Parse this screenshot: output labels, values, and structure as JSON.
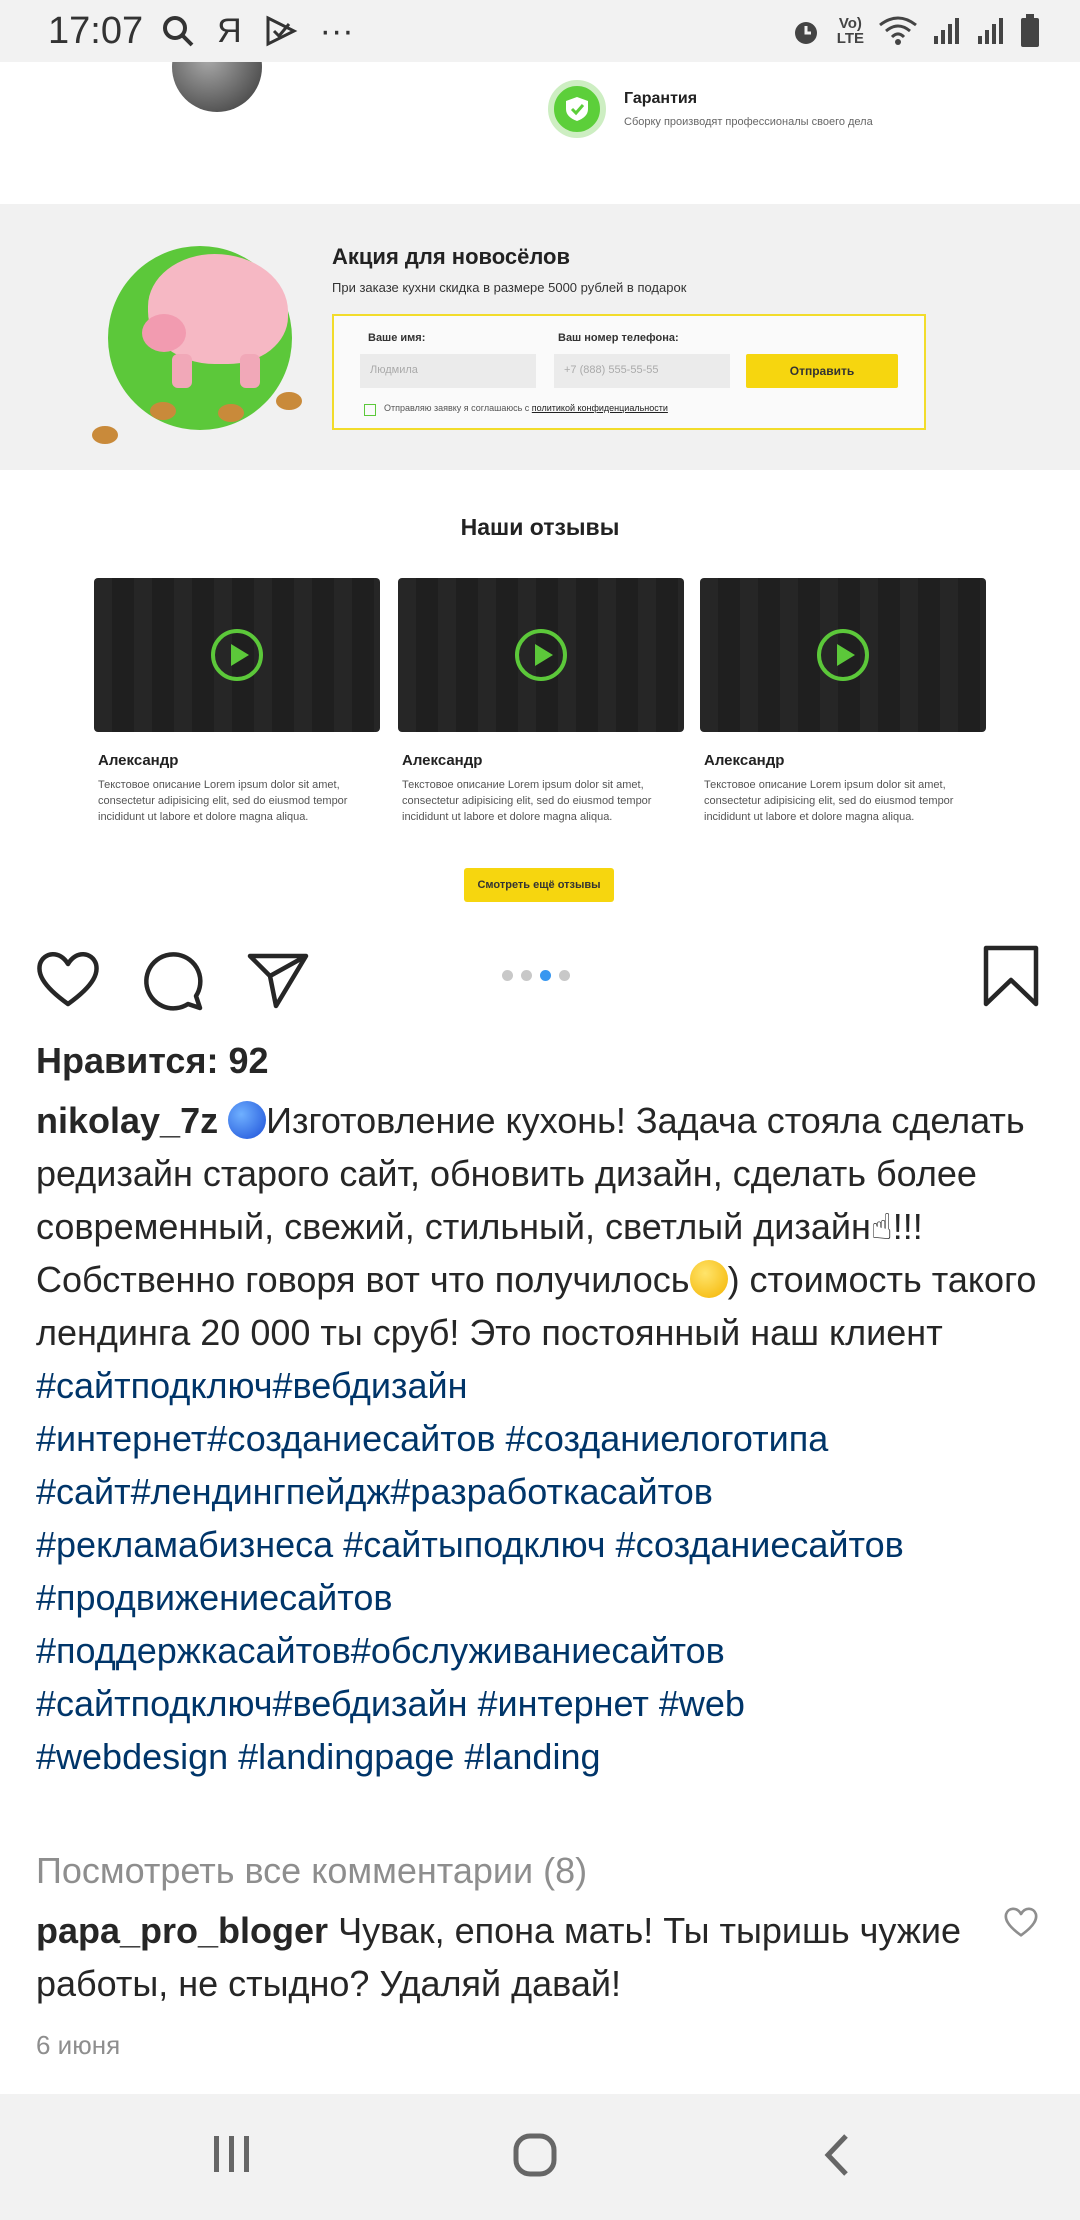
{
  "status_bar": {
    "time": "17:07",
    "app_letter": "Я",
    "more": "···",
    "lte_top": "Vo)",
    "lte_bottom": "LTE",
    "left_icons": [
      "search-icon",
      "yandex-icon",
      "send-notification-icon",
      "more-icon"
    ],
    "right_icons": [
      "alarm-icon",
      "volte-icon",
      "wifi-icon",
      "signal-icon",
      "signal-icon",
      "battery-icon"
    ]
  },
  "post_image": {
    "guarantee_title": "Гарантия",
    "guarantee_sub": "Сборку производят профессионалы своего дела",
    "promo_title": "Акция для новосёлов",
    "promo_sub": "При заказе кухни скидка в размере 5000 рублей в подарок",
    "name_label": "Ваше имя:",
    "name_placeholder": "Людмила",
    "phone_label": "Ваш номер телефона:",
    "phone_placeholder": "+7 (888) 555-55-55",
    "submit": "Отправить",
    "consent_prefix": "Отправляю заявку я соглашаюсь с",
    "consent_link": "политикой конфиденциальности",
    "reviews_title": "Наши отзывы",
    "reviews": [
      {
        "name": "Александр",
        "text": "Текстовое описание Lorem ipsum dolor sit amet, consectetur adipisicing elit, sed do eiusmod tempor incididunt ut labore et dolore magna aliqua."
      },
      {
        "name": "Александр",
        "text": "Текстовое описание Lorem ipsum dolor sit amet, consectetur adipisicing elit, sed do eiusmod tempor incididunt ut labore et dolore magna aliqua."
      },
      {
        "name": "Александр",
        "text": "Текстовое описание Lorem ipsum dolor sit amet, consectetur adipisicing elit, sed do eiusmod tempor incididunt ut labore et dolore magna aliqua."
      }
    ],
    "more_reviews": "Смотреть ещё отзывы"
  },
  "carousel": {
    "count": 4,
    "active_index": 3
  },
  "post": {
    "likes": "Нравится: 92",
    "username": "nikolay_7z",
    "caption_1": "Изготовление кухонь! Задача стояла сделать редизайн старого сайт, обновить дизайн, сделать более современный, свежий, стильный, светлый дизайн",
    "caption_2": "!!! Собственно говоря вот что получилось",
    "caption_3": ") стоимость такого лендинга 20 000 ты сруб! Это постоянный наш клиент",
    "hashtags_1": "#сайтподключ#вебдизайн",
    "hashtags_2": "#интернет#созданиесайтов #созданиелоготипа",
    "hashtags_3": "#сайт#лендингпейдж#разработкасайтов",
    "hashtags_4": "#рекламабизнеса #сайтыподключ #созданиесайтов",
    "hashtags_5": "#продвижениесайтов",
    "hashtags_6": "#поддержкасайтов#обслуживаниесайтов",
    "hashtags_7": "#сайтподключ#вебдизайн #интернет  #web",
    "hashtags_8": "#webdesign #landingpage #landing",
    "view_comments": "Посмотреть все комментарии (8)",
    "comment_user": "papa_pro_bloger",
    "comment_text": "Чувак, епона мать! Ты тыришь чужие работы, не стыдно? Удаляй давай!",
    "date": "6 июня"
  },
  "colors": {
    "hashtag": "#003569",
    "accent_green": "#5cc83a",
    "accent_yellow": "#f6d60f",
    "carousel_active": "#3897f0"
  }
}
